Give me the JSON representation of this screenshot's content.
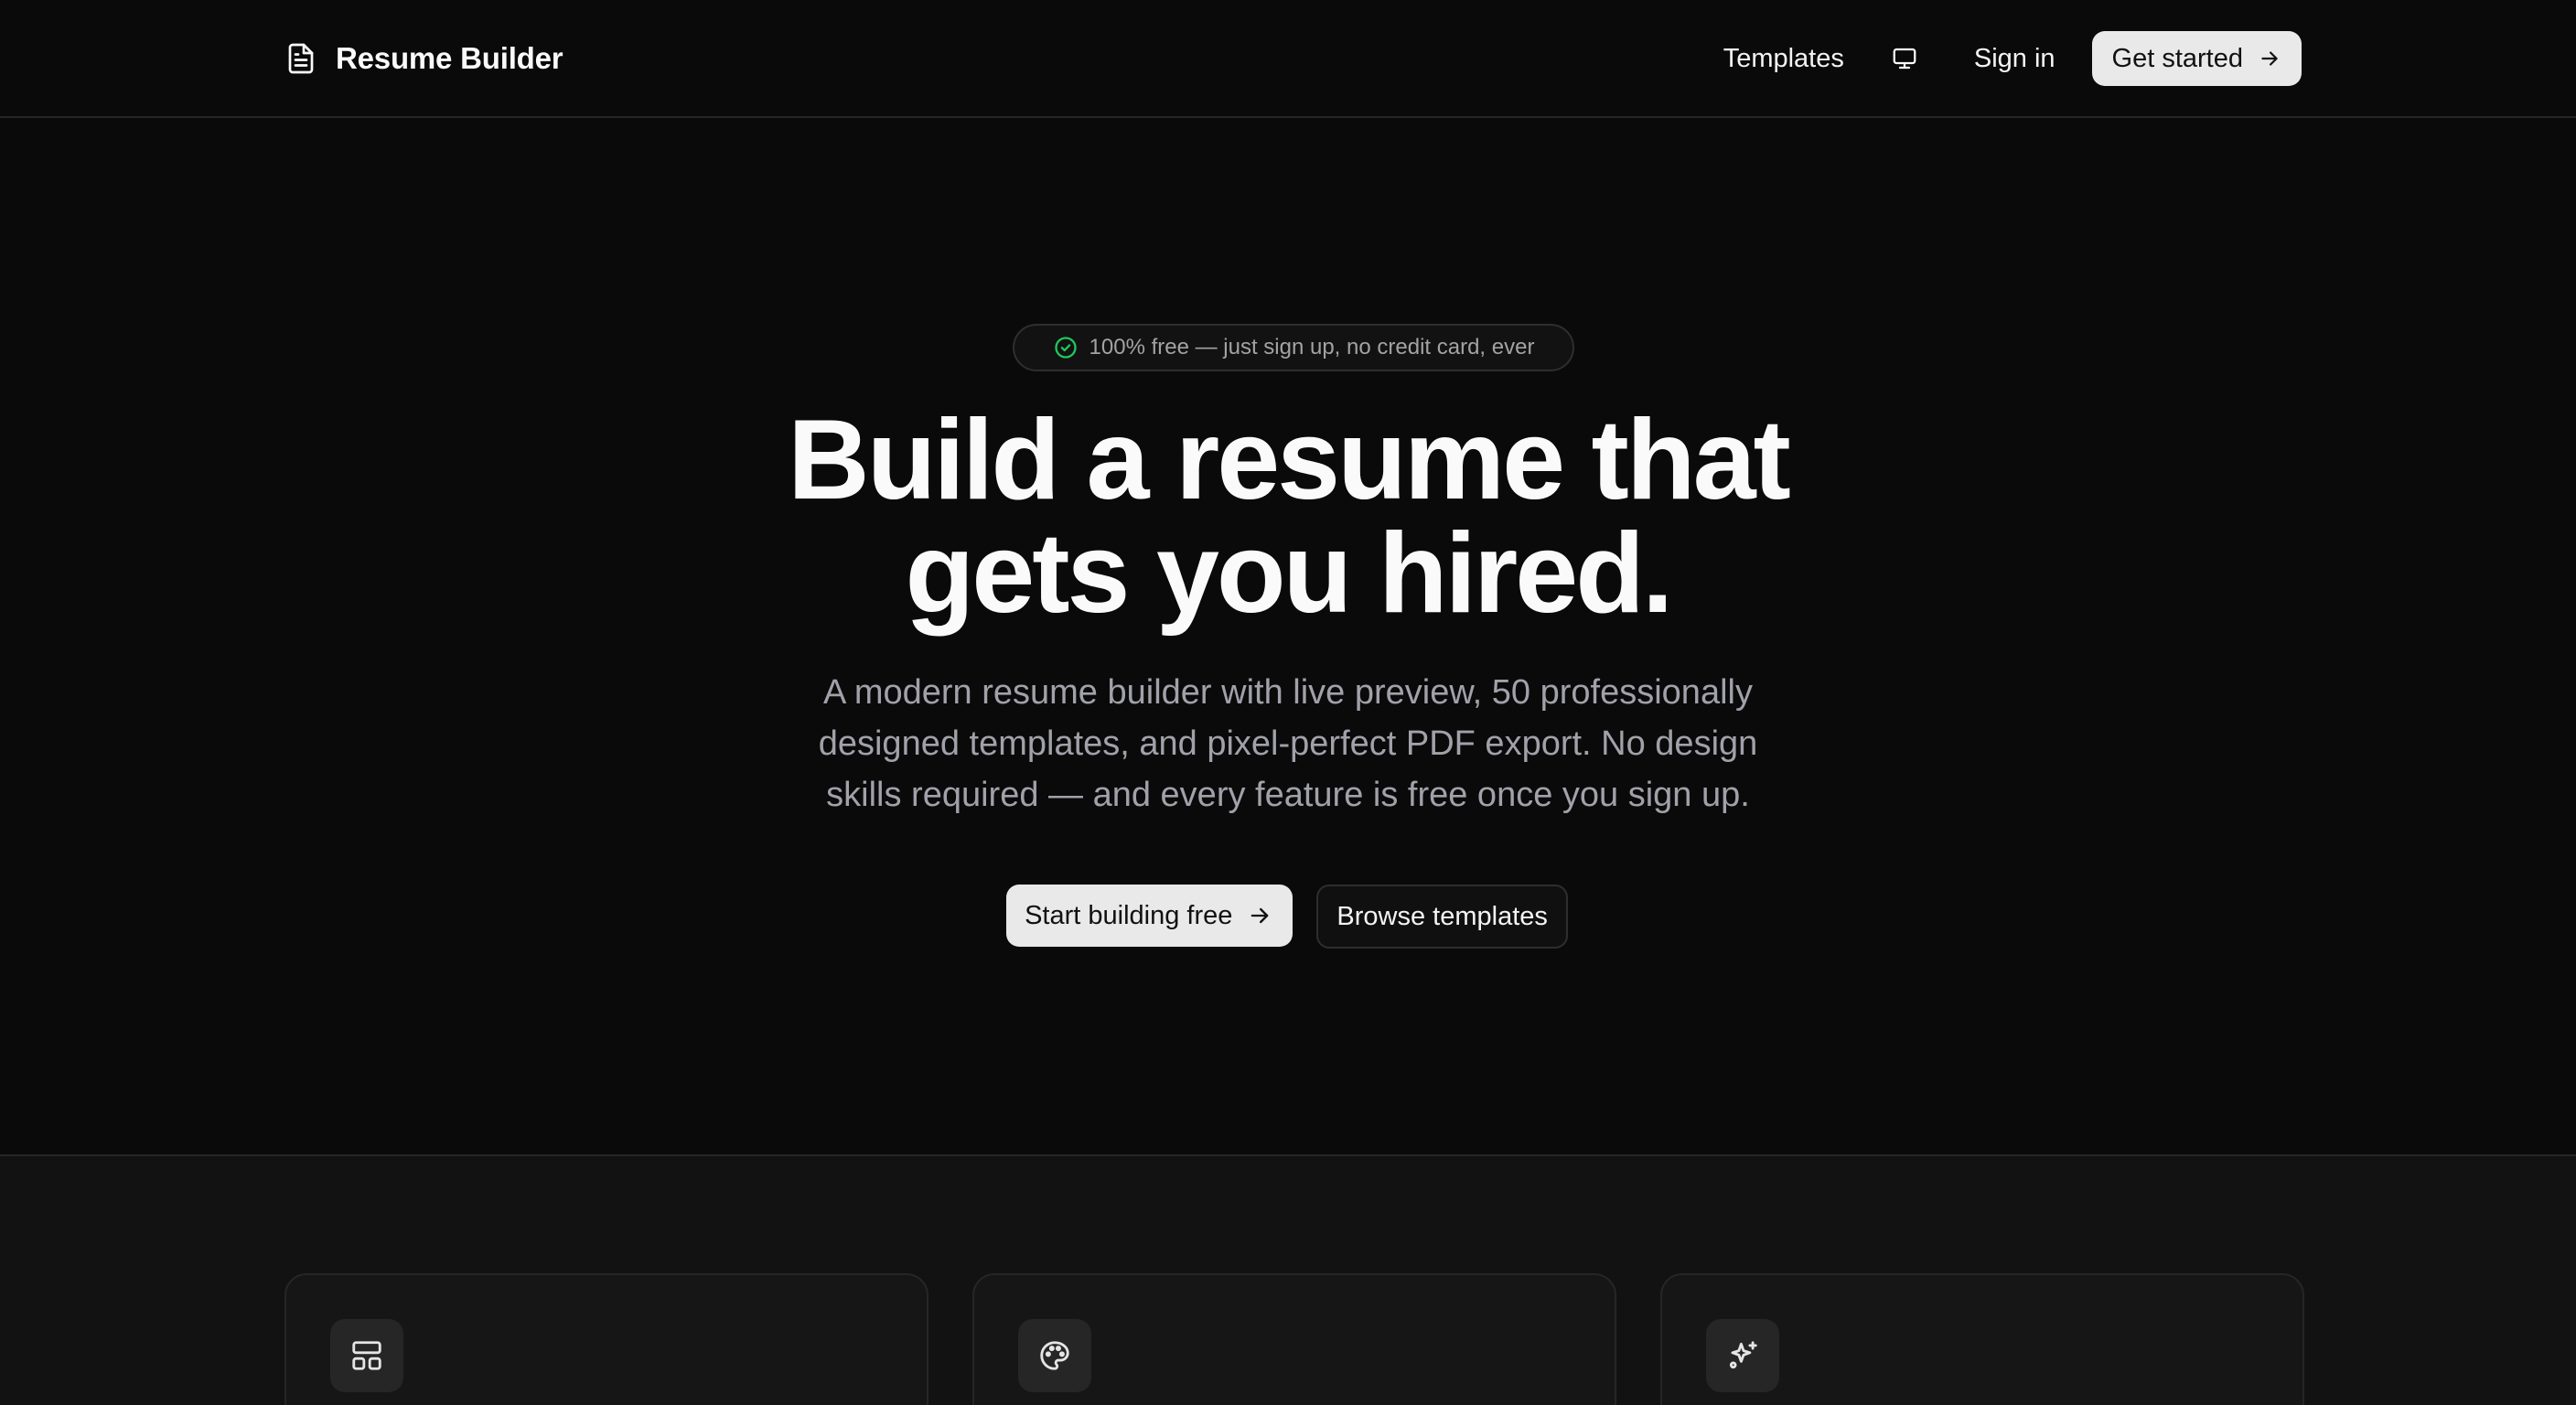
{
  "header": {
    "brand_name": "Resume Builder",
    "brand_icon": "file-text-icon",
    "nav": {
      "templates_label": "Templates",
      "display_icon": "monitor-icon",
      "signin_label": "Sign in",
      "get_started_label": "Get started"
    }
  },
  "hero": {
    "badge_icon": "check-circle-icon",
    "badge_text": "100% free — just sign up, no credit card, ever",
    "title_line1": "Build a resume that",
    "title_line2": "gets you hired.",
    "subtitle": "A modern resume builder with live preview, 50 professionally designed templates, and pixel-perfect PDF export. No design skills required — and every feature is free once you sign up.",
    "primary_cta": "Start building free",
    "secondary_cta": "Browse templates"
  },
  "features": {
    "cards": [
      {
        "icon": "layout-icon"
      },
      {
        "icon": "palette-icon"
      },
      {
        "icon": "sparkles-icon"
      }
    ]
  },
  "colors": {
    "background": "#0a0a0a",
    "surface": "#121212",
    "border": "#262626",
    "text": "#fafafa",
    "muted": "#a1a1aa",
    "button_light": "#e9e9ea",
    "accent_green": "#22c55e"
  }
}
